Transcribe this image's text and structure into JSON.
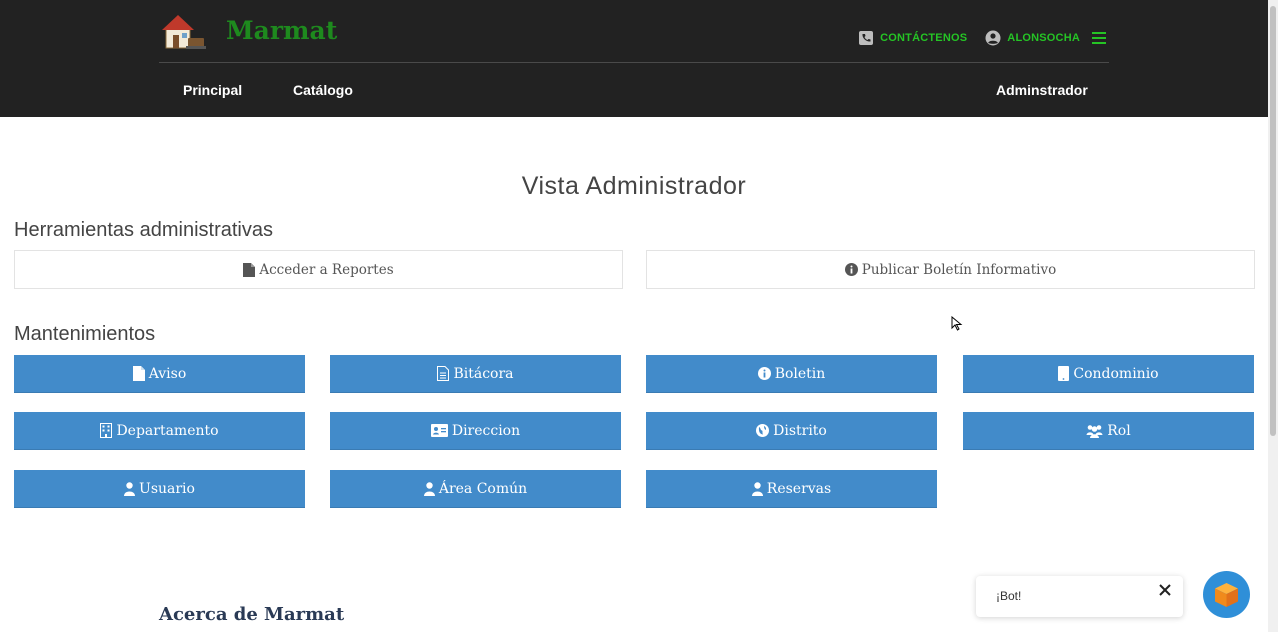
{
  "header": {
    "brand": "Marmat",
    "contact_label": "CONTÁCTENOS",
    "user_label": "ALONSOCHA",
    "nav": [
      {
        "label": "Principal"
      },
      {
        "label": "Catálogo"
      },
      {
        "label": "Adminstrador"
      }
    ]
  },
  "main": {
    "title": "Vista Administrador",
    "tools_heading": "Herramientas administrativas",
    "tools": [
      {
        "label": "Acceder a Reportes",
        "icon": "file-icon"
      },
      {
        "label": "Publicar Boletín Informativo",
        "icon": "info-circle-icon"
      }
    ],
    "maint_heading": "Mantenimientos",
    "maint": [
      {
        "label": "Aviso",
        "icon": "file-icon"
      },
      {
        "label": "Bitácora",
        "icon": "file-text-icon"
      },
      {
        "label": "Boletin",
        "icon": "info-circle-icon"
      },
      {
        "label": "Condominio",
        "icon": "tablet-icon"
      },
      {
        "label": "Departamento",
        "icon": "building-icon"
      },
      {
        "label": "Direccion",
        "icon": "id-card-icon"
      },
      {
        "label": "Distrito",
        "icon": "globe-icon"
      },
      {
        "label": "Rol",
        "icon": "users-icon"
      },
      {
        "label": "Usuario",
        "icon": "user-icon"
      },
      {
        "label": "Área Común",
        "icon": "user-icon"
      },
      {
        "label": "Reservas",
        "icon": "user-icon"
      }
    ]
  },
  "footer": {
    "about_title": "Acerca de Marmat"
  },
  "chat": {
    "bubble_text": "¡Bot!"
  },
  "colors": {
    "header_bg": "#222222",
    "accent_green": "#25c425",
    "button_blue": "#428bca"
  }
}
